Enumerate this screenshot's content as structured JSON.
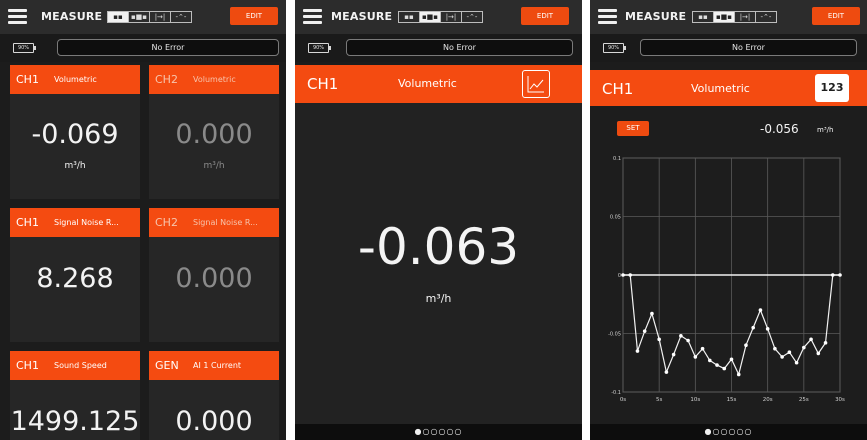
{
  "app": {
    "title": "MEASURE",
    "edit_label": "EDIT",
    "battery": "90%",
    "status": "No Error",
    "view_modes": [
      {
        "name": "grid-view-icon",
        "glyph": "▪▪"
      },
      {
        "name": "single-view-icon",
        "glyph": "▪■▪"
      },
      {
        "name": "detail-view-icon",
        "glyph": "|→|"
      },
      {
        "name": "trend-view-icon",
        "glyph": "-⌃-"
      }
    ]
  },
  "grid_screen": {
    "tiles": [
      {
        "channel": "CH1",
        "label": "Volumetric",
        "value": "-0.069",
        "unit": "m³/h",
        "active": true
      },
      {
        "channel": "CH2",
        "label": "Volumetric",
        "value": "0.000",
        "unit": "m³/h",
        "active": false
      },
      {
        "channel": "CH1",
        "label": "Signal Noise R...",
        "value": "8.268",
        "unit": "",
        "active": true
      },
      {
        "channel": "CH2",
        "label": "Signal Noise R...",
        "value": "0.000",
        "unit": "",
        "active": false
      },
      {
        "channel": "CH1",
        "label": "Sound Speed",
        "value": "1499.125",
        "unit": "",
        "active": true
      },
      {
        "channel": "GEN",
        "label": "AI 1 Current",
        "value": "0.000",
        "unit": "",
        "active": true
      }
    ]
  },
  "single_screen": {
    "channel": "CH1",
    "label": "Volumetric",
    "value": "-0.063",
    "unit": "m³/h",
    "page_indicator": "●○○○○○"
  },
  "trend_screen": {
    "channel": "CH1",
    "label": "Volumetric",
    "numeric_button": "123",
    "set_label": "SET",
    "current_value": "-0.056",
    "unit": "m³/h",
    "page_indicator": "●○○○○○",
    "chart_data": {
      "type": "line",
      "xlabel": "",
      "ylabel": "",
      "x_ticks": [
        "0s",
        "5s",
        "10s",
        "15s",
        "20s",
        "25s",
        "30s"
      ],
      "y_ticks": [
        "0.1",
        "0.05",
        "0",
        "-0.05",
        "-0.1"
      ],
      "xlim": [
        0,
        30
      ],
      "ylim": [
        -0.1,
        0.1
      ],
      "grid": true,
      "x": [
        0,
        1,
        2,
        3,
        4,
        5,
        6,
        7,
        8,
        9,
        10,
        11,
        12,
        13,
        14,
        15,
        16,
        17,
        18,
        19,
        20,
        21,
        22,
        23,
        24,
        25,
        26,
        27,
        28,
        29,
        30
      ],
      "values": [
        0.0,
        0.0,
        -0.065,
        -0.048,
        -0.033,
        -0.055,
        -0.083,
        -0.068,
        -0.052,
        -0.056,
        -0.07,
        -0.063,
        -0.073,
        -0.077,
        -0.08,
        -0.072,
        -0.085,
        -0.06,
        -0.045,
        -0.03,
        -0.046,
        -0.063,
        -0.07,
        -0.066,
        -0.075,
        -0.062,
        -0.055,
        -0.067,
        -0.058,
        0.0,
        0.0
      ],
      "reference_line": 0
    }
  }
}
